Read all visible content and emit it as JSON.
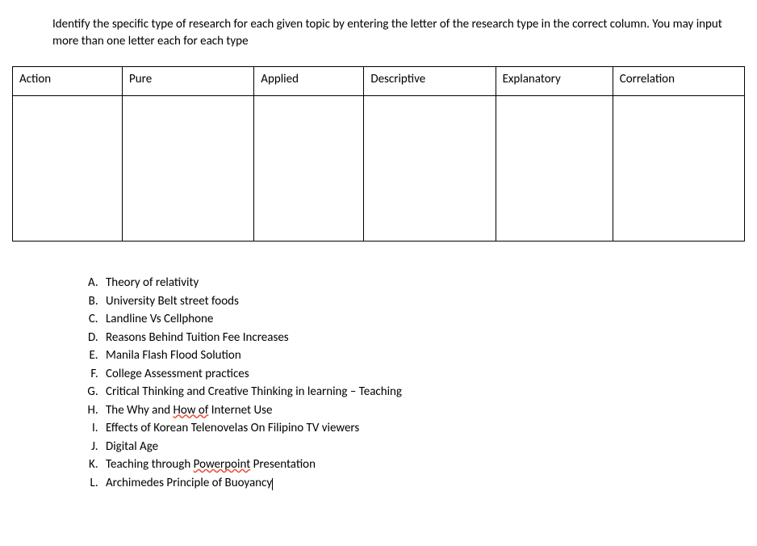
{
  "instructions": "Identify the specific type of research for each given topic by entering the letter of the research type in the correct column. You may input more than one letter each for each type",
  "table": {
    "headers": {
      "action": "Action",
      "pure": "Pure",
      "applied": "Applied",
      "descriptive": "Descriptive",
      "explanatory": "Explanatory",
      "correlation": "Correlation"
    }
  },
  "items": {
    "a": "Theory of relativity",
    "b": "University Belt street foods",
    "c": "Landline Vs Cellphone",
    "d": "Reasons Behind Tuition Fee Increases",
    "e": "Manila Flash Flood Solution",
    "f": "College Assessment practices",
    "g": "Critical Thinking and Creative Thinking in learning – Teaching",
    "h_pre": "The Why and ",
    "h_err": "How  of",
    "h_post": " Internet Use",
    "i": "Effects of Korean Telenovelas On Filipino TV viewers",
    "j": "Digital Age",
    "k_pre": "Teaching through ",
    "k_err": "Powerpoint",
    "k_post": " Presentation",
    "l": "Archimedes Principle of Buoyancy"
  }
}
